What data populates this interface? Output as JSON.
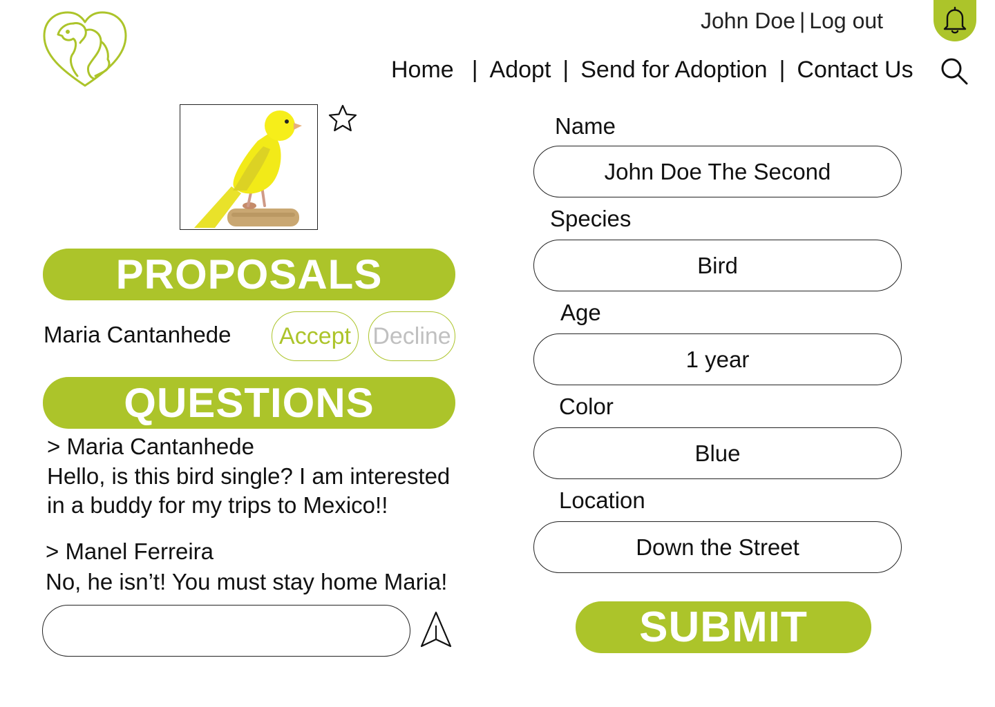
{
  "header": {
    "user_name": "John Doe",
    "user_separator": "|",
    "logout_label": "Log out",
    "nav": [
      {
        "label": "Home"
      },
      {
        "label": "Adopt"
      },
      {
        "label": "Send for Adoption"
      },
      {
        "label": "Contact Us"
      }
    ],
    "nav_separator": "|",
    "icons": {
      "logo": "pet-heart-logo",
      "notifications": "bell-icon",
      "search": "search-icon"
    }
  },
  "pet": {
    "photo": "yellow-canary-photo",
    "favorite_icon": "star-icon"
  },
  "proposals": {
    "title": "PROPOSALS",
    "items": [
      {
        "name": "Maria Cantanhede",
        "accept_label": "Accept",
        "decline_label": "Decline"
      }
    ]
  },
  "questions": {
    "title": "QUESTIONS",
    "items": [
      {
        "author": "> Maria Cantanhede",
        "text": "Hello, is this bird single? I am interested in a buddy for my trips to Mexico!!"
      },
      {
        "author": "> Manel Ferreira",
        "text": "No, he isn’t! You must stay home Maria!"
      }
    ],
    "reply_value": "",
    "send_icon": "send-icon"
  },
  "form": {
    "fields": [
      {
        "label": "Name",
        "value": "John Doe The Second"
      },
      {
        "label": "Species",
        "value": "Bird"
      },
      {
        "label": "Age",
        "value": "1 year"
      },
      {
        "label": "Color",
        "value": "Blue"
      },
      {
        "label": "Location",
        "value": "Down the Street"
      }
    ],
    "submit_label": "SUBMIT"
  },
  "colors": {
    "accent": "#acc42a",
    "text": "#111111",
    "muted": "#c0c0c0",
    "border": "#222222"
  }
}
